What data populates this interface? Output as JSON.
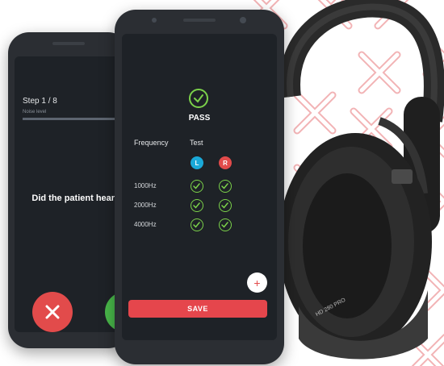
{
  "colors": {
    "accent_red": "#e5464c",
    "pass_green": "#7bd14a",
    "left_ear": "#1aa9d8",
    "right_ear": "#e24b4b",
    "screen_bg": "#1e2227"
  },
  "back_phone": {
    "step": "Step 1 / 8",
    "noise_label": "Noise level",
    "noise_level": 0.7,
    "question": "Did the patient hear the tone?"
  },
  "front_phone": {
    "result": "PASS",
    "frequency_header": "Frequency",
    "test_header": "Test",
    "left_label": "L",
    "right_label": "R",
    "rows": [
      {
        "freq": "1000Hz"
      },
      {
        "freq": "2000Hz"
      },
      {
        "freq": "4000Hz"
      }
    ],
    "add_icon": "plus-icon",
    "save_label": "SAVE"
  },
  "headphones_label": "HD 280 PRO"
}
